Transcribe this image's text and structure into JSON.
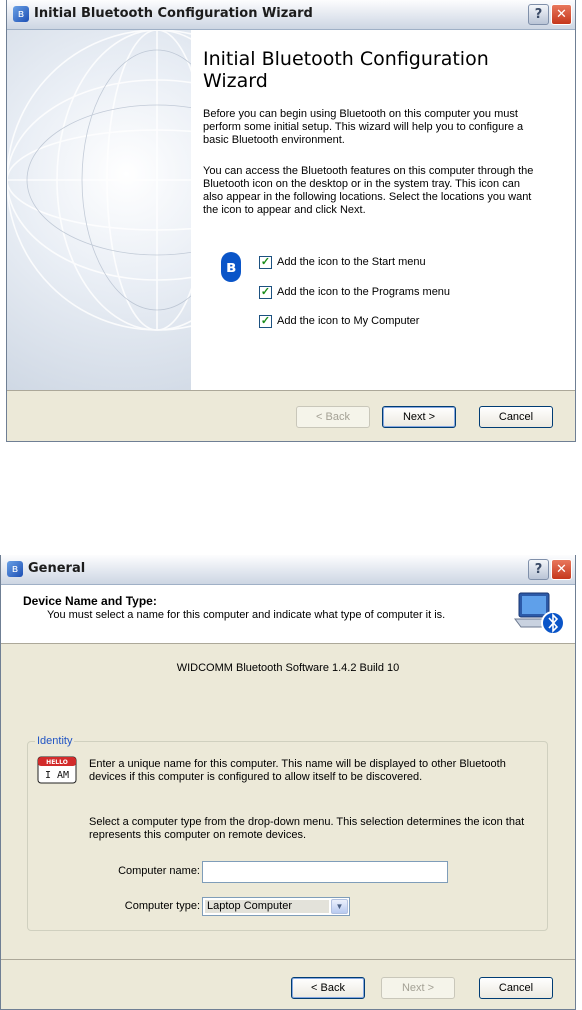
{
  "wizard": {
    "window_title": "Initial Bluetooth Configuration Wizard",
    "heading": "Initial Bluetooth Configuration Wizard",
    "paragraph1": "Before you can begin using Bluetooth on this computer you must perform some initial setup. This wizard will help you to configure a basic Bluetooth environment.",
    "paragraph2": "You can access the Bluetooth features on this computer through the Bluetooth icon on the desktop or in the system tray. This icon can also appear in the following locations. Select the locations you want the icon to appear and click Next.",
    "options": [
      {
        "label": "Add the icon to the Start menu",
        "checked": true
      },
      {
        "label": "Add the icon to the Programs menu",
        "checked": true
      },
      {
        "label": "Add the icon to My Computer",
        "checked": true
      }
    ],
    "buttons": {
      "back": "< Back",
      "next": "Next >",
      "cancel": "Cancel"
    },
    "back_enabled": false
  },
  "general": {
    "window_title": "General",
    "header_title": "Device Name and Type:",
    "header_subtitle": "You must select a name for this computer and indicate what type of computer it is.",
    "version": "WIDCOMM Bluetooth Software 1.4.2 Build 10",
    "group_title": "Identity",
    "hello_icon_text": {
      "top": "HELLO",
      "bottom": "I AM"
    },
    "paragraph1": "Enter a unique name for this computer.  This name will be displayed to other Bluetooth devices if this computer is configured to allow itself to be discovered.",
    "paragraph2": "Select a computer type from the drop-down menu.  This selection determines the icon that represents this computer on remote devices.",
    "computer_name_label": "Computer name:",
    "computer_name_value": "",
    "computer_type_label": "Computer type:",
    "computer_type_value": "Laptop Computer",
    "buttons": {
      "back": "< Back",
      "next": "Next >",
      "cancel": "Cancel"
    },
    "next_enabled": false
  },
  "colors": {
    "dialog_bg": "#ece9d8",
    "accent_blue": "#0a55c8",
    "group_title": "#2155c4",
    "close_red": "#c5371c"
  },
  "icons": {
    "window": "bluetooth-window-icon",
    "help": "help-icon",
    "close": "close-icon",
    "bluetooth": "bluetooth-icon",
    "laptop": "laptop-bluetooth-icon",
    "nametag": "hello-name-tag-icon"
  }
}
